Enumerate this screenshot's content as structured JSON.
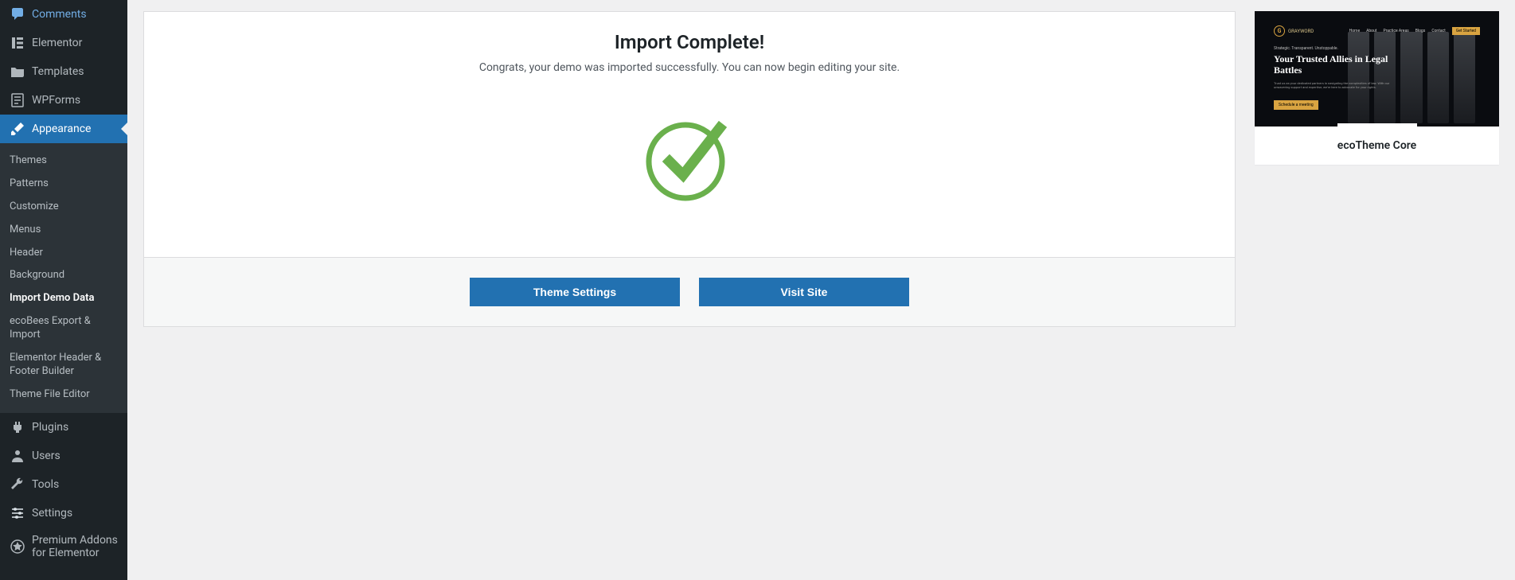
{
  "sidebar": {
    "items": [
      {
        "label": "Comments",
        "icon": "comments"
      },
      {
        "label": "Elementor",
        "icon": "elementor"
      },
      {
        "label": "Templates",
        "icon": "folder"
      },
      {
        "label": "WPForms",
        "icon": "wpforms"
      },
      {
        "label": "Appearance",
        "icon": "brush",
        "active": true
      },
      {
        "label": "Plugins",
        "icon": "plug"
      },
      {
        "label": "Users",
        "icon": "user"
      },
      {
        "label": "Tools",
        "icon": "wrench"
      },
      {
        "label": "Settings",
        "icon": "sliders"
      },
      {
        "label": "Premium Addons for Elementor",
        "icon": "star"
      }
    ],
    "submenu": [
      {
        "label": "Themes"
      },
      {
        "label": "Patterns"
      },
      {
        "label": "Customize"
      },
      {
        "label": "Menus"
      },
      {
        "label": "Header"
      },
      {
        "label": "Background"
      },
      {
        "label": "Import Demo Data",
        "current": true
      },
      {
        "label": "ecoBees Export & Import"
      },
      {
        "label": "Elementor Header & Footer Builder"
      },
      {
        "label": "Theme File Editor"
      }
    ]
  },
  "main": {
    "title": "Import Complete!",
    "subtitle": "Congrats, your demo was imported successfully. You can now begin editing your site.",
    "buttons": {
      "settings": "Theme Settings",
      "visit": "Visit Site"
    }
  },
  "side": {
    "title": "ecoTheme Core",
    "thumb": {
      "brand": "GRAYWORD",
      "nav": [
        "Home",
        "About",
        "Practice Areas",
        "Blogs",
        "Contact"
      ],
      "cta_nav": "Get Started",
      "sub": "Strategic. Transparent. Unstoppable.",
      "hero": "Your Trusted Allies in Legal Battles",
      "desc": "Trust us as your dedicated partners in navigating the complexities of law. With our unwavering support and expertise, we're here to advocate for your rights.",
      "cta": "Schedule a meeting"
    }
  }
}
